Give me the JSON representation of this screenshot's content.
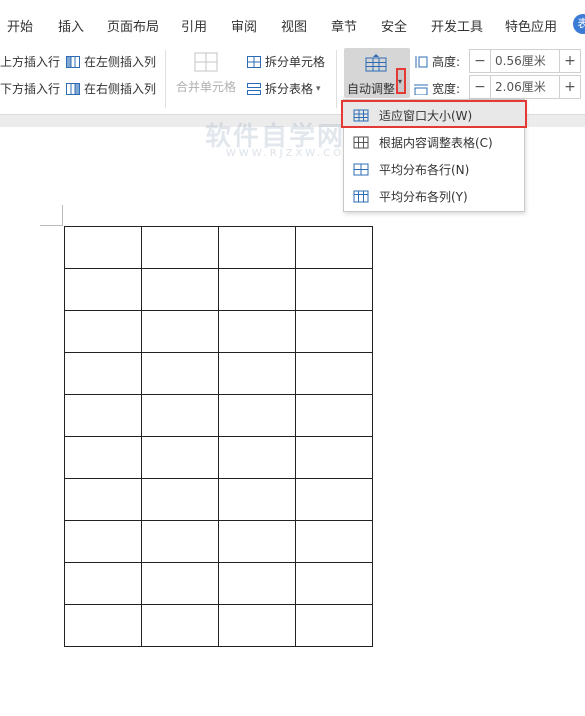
{
  "tabs": [
    "开始",
    "插入",
    "页面布局",
    "引用",
    "审阅",
    "视图",
    "章节",
    "安全",
    "开发工具",
    "特色应用"
  ],
  "tab_edge_char": "表",
  "ribbon": {
    "insert_above": "上方插入行",
    "insert_below": "下方插入行",
    "insert_left": "在左侧插入列",
    "insert_right": "在右侧插入列",
    "merge_cells": "合并单元格",
    "split_cells": "拆分单元格",
    "split_table": "拆分表格",
    "auto_fit": "自动调整",
    "height_label": "高度:",
    "height_value": "0.56厘米",
    "width_label": "宽度:",
    "width_value": "2.06厘米",
    "minus": "−",
    "plus": "+"
  },
  "menu": {
    "items": [
      "适应窗口大小(W)",
      "根据内容调整表格(C)",
      "平均分布各行(N)",
      "平均分布各列(Y)"
    ],
    "highlighted_index": 0
  },
  "watermark": {
    "text": "软件自学网",
    "sub": "WWW.RJZXW.COM"
  },
  "document_table": {
    "rows": 10,
    "cols": 4
  },
  "colors": {
    "highlight_box": "#e53935",
    "accent": "#3a7bd5"
  }
}
